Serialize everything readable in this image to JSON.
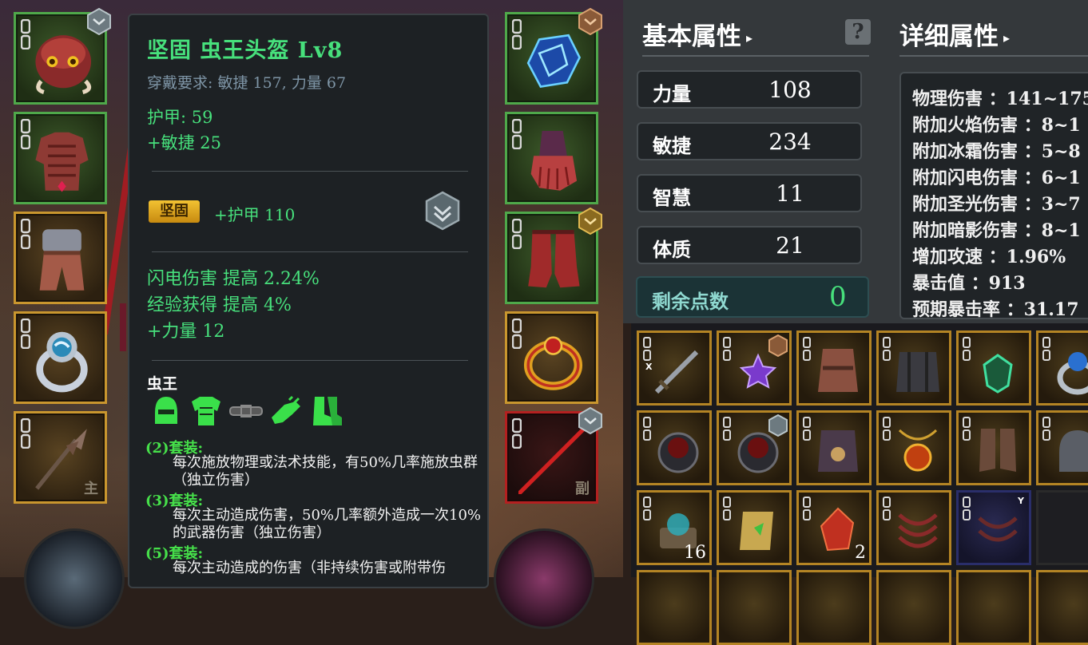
{
  "tooltip": {
    "title": "坚固  虫王头盔  Lv8",
    "requirement": "穿戴要求:   敏捷 157, 力量 67",
    "armor": "护甲:  59",
    "agility_bonus": "+敏捷  25",
    "quality_badge": "坚固",
    "quality_bonus": "+护甲  110",
    "affixes": [
      "闪电伤害  提高  2.24%",
      "经验获得  提高  4%",
      "+力量  12"
    ],
    "set_name": "虫王",
    "set_pieces": [
      "helmet-icon",
      "chest-armor-icon",
      "belt-icon",
      "gloves-icon",
      "boots-icon"
    ],
    "set_bonuses": [
      {
        "label": "(2)套装:",
        "text": "每次施放物理或法术技能，有50%几率施放虫群（独立伤害）"
      },
      {
        "label": "(3)套装:",
        "text": "每次主动造成伤害，50%几率额外造成一次10%的武器伤害（独立伤害）"
      },
      {
        "label": "(5)套装:",
        "text": "每次主动造成的伤害（非持续伤害或附带伤"
      }
    ]
  },
  "equipment": {
    "main_hand_tag": "主",
    "off_hand_tag": "副"
  },
  "basic_attributes": {
    "heading": "基本属性",
    "stats": [
      {
        "label": "力量",
        "value": "108"
      },
      {
        "label": "敏捷",
        "value": "234"
      },
      {
        "label": "智慧",
        "value": "11"
      },
      {
        "label": "体质",
        "value": "21"
      }
    ],
    "remaining_label": "剩余点数",
    "remaining_value": "0"
  },
  "detail_attributes": {
    "heading": "详细属性",
    "rows": [
      "物理伤害 ：141~175",
      "附加火焰伤害 ：8~1",
      "附加冰霜伤害 ：5~8",
      "附加闪电伤害 ：6~1",
      "附加圣光伤害 ：3~7",
      "附加暗影伤害 ：8~1",
      "增加攻速 ：1.96%",
      "暴击值 ：913",
      "预期暴击率 ：31.17"
    ]
  },
  "inventory": {
    "quantities": {
      "scroll": "16",
      "crystal": "2"
    },
    "marks": {
      "sword": "X",
      "claws": "Y"
    }
  },
  "colors": {
    "green_text": "#47e07c",
    "set_green": "#46e04a",
    "gold_border": "#c9962e",
    "green_border": "#4fa84a",
    "red_border": "#b42020"
  }
}
